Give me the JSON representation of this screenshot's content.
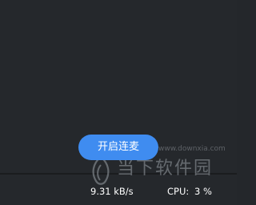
{
  "main": {
    "connect_button_label": "开启连麦"
  },
  "status_bar": {
    "speed": "9.31 kB/s",
    "cpu_label": "CPU:",
    "cpu_value": "3 %"
  },
  "watermark": {
    "title": "当下软件园",
    "url": "www.downxia.com"
  },
  "colors": {
    "background": "#24272b",
    "accent": "#3f8cf0",
    "text": "#ffffff"
  }
}
